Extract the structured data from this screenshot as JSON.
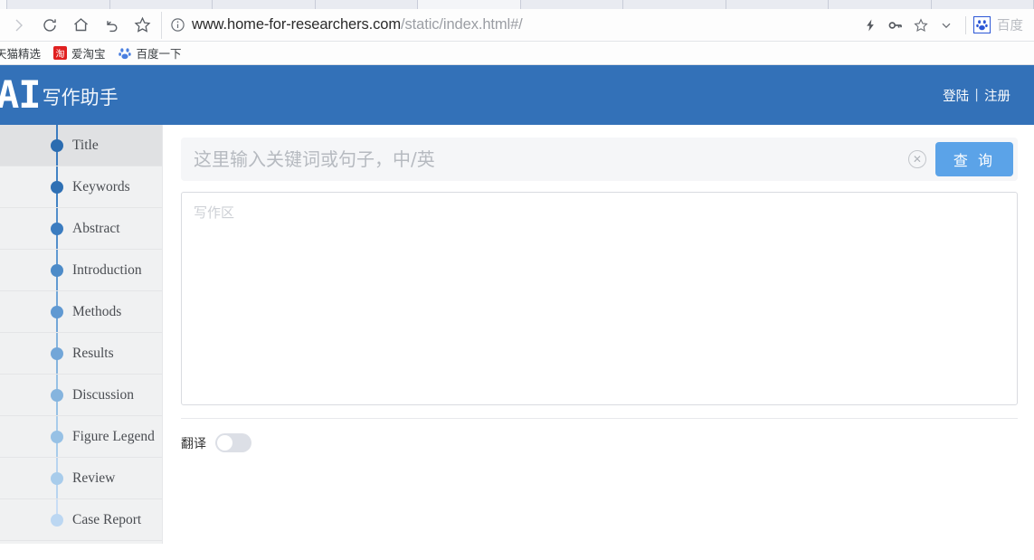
{
  "browser": {
    "toolbar_buttons": [
      {
        "name": "forward-button",
        "icon": "chevron-right-icon",
        "disabled": true
      },
      {
        "name": "reload-button",
        "icon": "reload-icon",
        "disabled": false
      },
      {
        "name": "home-button",
        "icon": "home-icon",
        "disabled": false
      },
      {
        "name": "back-button",
        "icon": "undo-arrow-icon",
        "disabled": false
      },
      {
        "name": "bookmark-star-button",
        "icon": "star-icon",
        "disabled": false
      }
    ],
    "url": {
      "domain": "www.home-for-researchers.com",
      "path": "/static/index.html#/",
      "security_icon": "info-circle-icon"
    },
    "right_buttons": [
      {
        "name": "lightning-button",
        "icon": "lightning-icon"
      },
      {
        "name": "password-key-button",
        "icon": "key-icon"
      },
      {
        "name": "favorite-star-button",
        "icon": "star-icon"
      },
      {
        "name": "menu-chevron-button",
        "icon": "chevron-down-icon"
      }
    ],
    "search_engine": {
      "label": "百度",
      "icon": "baidu-paw-icon"
    },
    "bookmarks": [
      {
        "label": "天猫精选",
        "icon": "tmall-icon"
      },
      {
        "label": "爱淘宝",
        "icon": "taobao-icon"
      },
      {
        "label": "百度一下",
        "icon": "baidu-paw-icon"
      }
    ],
    "tab_count": 11,
    "active_tab_index": 4
  },
  "header": {
    "logo": "AI",
    "brand_name": "写作助手",
    "login_label": "登陆",
    "separator": "|",
    "register_label": "注册",
    "background_color": "#3371b8"
  },
  "sidebar": {
    "items": [
      {
        "label": "Title",
        "dot_color": "#2b6cb0",
        "rail_color": "#3b7cc0",
        "active": true
      },
      {
        "label": "Keywords",
        "dot_color": "#2f70b4",
        "rail_color": "#4182c4",
        "active": false
      },
      {
        "label": "Abstract",
        "dot_color": "#3b7cc0",
        "rail_color": "#528ecb",
        "active": false
      },
      {
        "label": "Introduction",
        "dot_color": "#4d8bc8",
        "rail_color": "#6099d2",
        "active": false
      },
      {
        "label": "Methods",
        "dot_color": "#6099d2",
        "rail_color": "#72a6d8",
        "active": false
      },
      {
        "label": "Results",
        "dot_color": "#72a6d8",
        "rail_color": "#85b4de",
        "active": false
      },
      {
        "label": "Discussion",
        "dot_color": "#85b4de",
        "rail_color": "#97c1e5",
        "active": false
      },
      {
        "label": "Figure Legend",
        "dot_color": "#97c1e5",
        "rail_color": "#a8cceb",
        "active": false
      },
      {
        "label": "Review",
        "dot_color": "#a8cceb",
        "rail_color": "#b8d4f0",
        "active": false
      },
      {
        "label": "Case Report",
        "dot_color": "#bcd7f2",
        "rail_color": "#c8ddf5",
        "active": false
      }
    ]
  },
  "main": {
    "search": {
      "placeholder": "这里输入关键词或句子，中/英",
      "value": "",
      "clear_icon": "close-circle-icon",
      "query_button_label": "查 询",
      "query_button_color": "#5ba3e8"
    },
    "editor": {
      "placeholder": "写作区",
      "value": ""
    },
    "translate": {
      "label": "翻译",
      "enabled": false
    }
  }
}
